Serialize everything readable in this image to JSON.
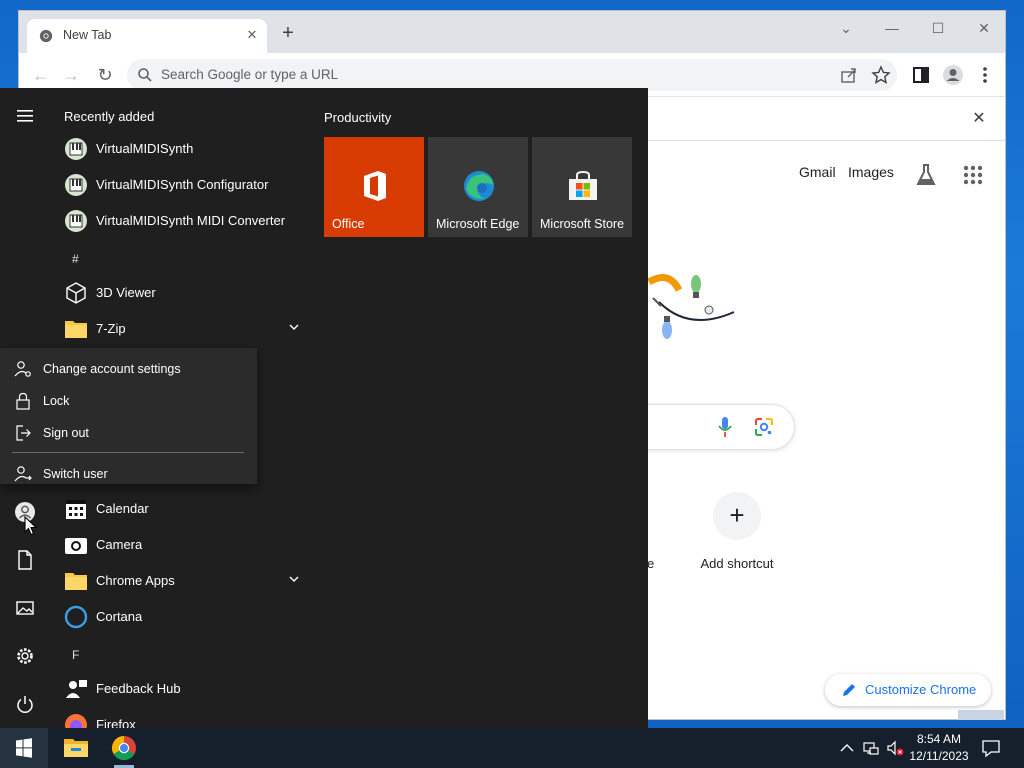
{
  "browser": {
    "tab_title": "New Tab",
    "tab_close": "✕",
    "new_tab": "+",
    "window_controls": {
      "dropdown": "⌄",
      "minimize": "—",
      "maximize": "☐",
      "close": "✕"
    },
    "nav": {
      "back": "←",
      "forward": "→",
      "reload": "↻"
    },
    "omnibox_placeholder": "Search Google or type a URL",
    "infobar_close": "✕",
    "icons": [
      "search-icon",
      "share-icon",
      "star-icon",
      "side-panel-icon",
      "profile-icon",
      "more-icon"
    ]
  },
  "newtab_page": {
    "links": {
      "gmail": "Gmail",
      "images": "Images"
    },
    "shortcut_plus": "+",
    "shortcut_label": "Add shortcut",
    "partial_shortcut_text": "e",
    "customize_label": "Customize Chrome"
  },
  "start_menu": {
    "recently_added_heading": "Recently added",
    "recently_added": [
      {
        "label": "VirtualMIDISynth",
        "icon": "virtualmidisynth-icon"
      },
      {
        "label": "VirtualMIDISynth Configurator",
        "icon": "virtualmidisynth-icon"
      },
      {
        "label": "VirtualMIDISynth MIDI Converter",
        "icon": "virtualmidisynth-icon"
      }
    ],
    "hash_heading": "#",
    "apps_hash": [
      {
        "label": "3D Viewer",
        "icon": "cube-icon"
      },
      {
        "label": "7-Zip",
        "icon": "folder-icon",
        "expandable": true
      }
    ],
    "apps_c": [
      {
        "label": "Calendar",
        "icon": "calendar-icon"
      },
      {
        "label": "Camera",
        "icon": "camera-icon"
      },
      {
        "label": "Chrome Apps",
        "icon": "folder-icon",
        "expandable": true
      },
      {
        "label": "Cortana",
        "icon": "cortana-icon"
      }
    ],
    "f_heading": "F",
    "apps_f": [
      {
        "label": "Feedback Hub",
        "icon": "feedback-icon"
      },
      {
        "label": "Firefox",
        "icon": "firefox-icon"
      }
    ],
    "tile_group_title": "Productivity",
    "tiles": [
      {
        "label": "Office",
        "color": "#d83b01",
        "icon": "office-icon"
      },
      {
        "label": "Microsoft Edge",
        "color": "#383838",
        "icon": "edge-icon"
      },
      {
        "label": "Microsoft Store",
        "color": "#383838",
        "icon": "store-icon"
      }
    ],
    "account_menu": [
      {
        "label": "Change account settings",
        "icon": "account-settings-icon"
      },
      {
        "label": "Lock",
        "icon": "lock-icon"
      },
      {
        "label": "Sign out",
        "icon": "sign-out-icon"
      },
      {
        "label": "Switch user",
        "icon": "switch-user-icon"
      }
    ],
    "rail_icons": [
      "hamburger-icon",
      "user-icon",
      "documents-icon",
      "pictures-icon",
      "settings-icon",
      "power-icon"
    ]
  },
  "taskbar": {
    "time": "8:54 AM",
    "date": "12/11/2023",
    "pinned": [
      "start-icon",
      "file-explorer-icon",
      "chrome-icon"
    ],
    "tray": [
      "chevron-up-icon",
      "network-icon",
      "volume-muted-icon",
      "notification-icon"
    ]
  },
  "colors": {
    "start_bg": "#1f1f1f",
    "office_tile": "#d83b01",
    "tile_bg": "#383838",
    "taskbar_bg": "#15202c",
    "accent_blue": "#1a73e8"
  }
}
